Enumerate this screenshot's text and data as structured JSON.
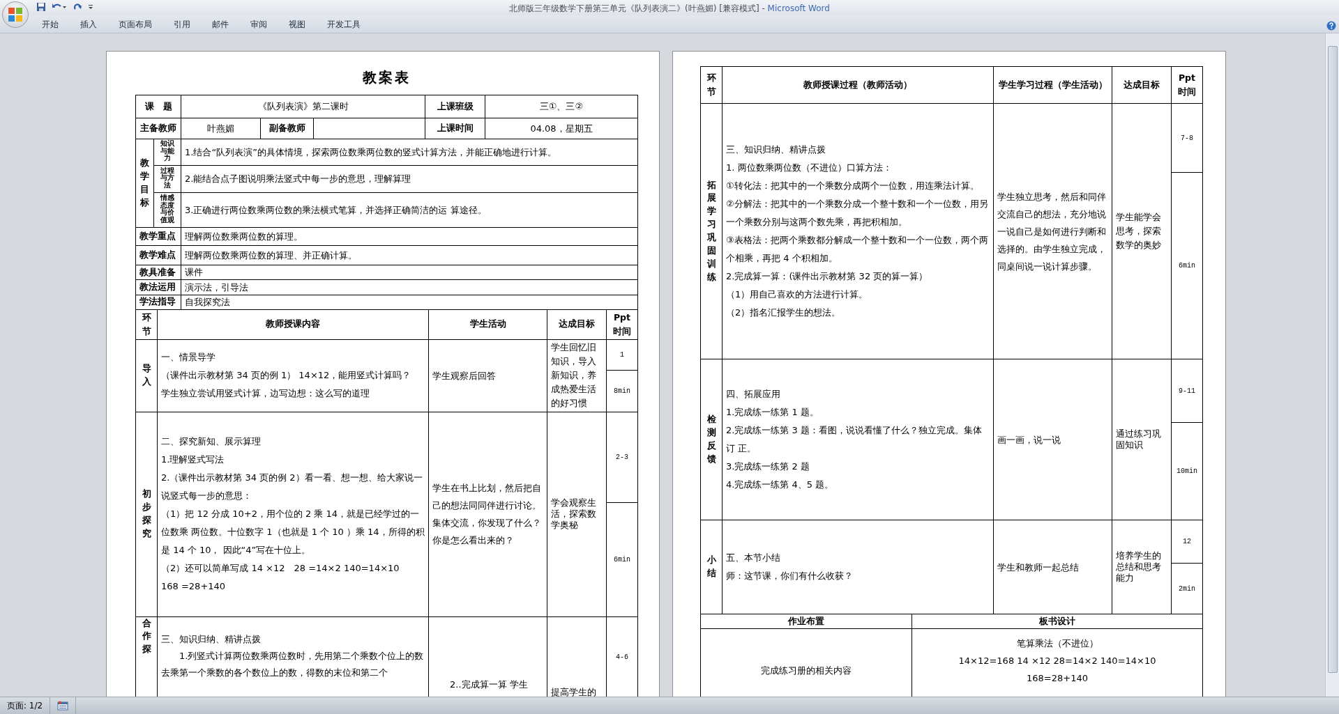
{
  "window": {
    "title": "北师版三年级数学下册第三单元《队列表演二》(叶燕媚) [兼容模式] -",
    "app_name": "Microsoft Word"
  },
  "ribbon_tabs": [
    {
      "label": "开始",
      "selected": false
    },
    {
      "label": "插入",
      "selected": false
    },
    {
      "label": "页面布局",
      "selected": false
    },
    {
      "label": "引用",
      "selected": false
    },
    {
      "label": "邮件",
      "selected": false
    },
    {
      "label": "审阅",
      "selected": false
    },
    {
      "label": "视图",
      "selected": false
    },
    {
      "label": "开发工具",
      "selected": false
    }
  ],
  "page_1": {
    "heading": "教案表",
    "info": {
      "topic_label": "课　题",
      "topic": "《队列表演》第二课时",
      "class_label": "上课班级",
      "class": "三①、三②",
      "lead_label": "主备教师",
      "lead": "叶燕媚",
      "assist_label": "副备教师",
      "time_label": "上课时间",
      "time": "04.08，星期五"
    },
    "objectives": {
      "label": "教学目标",
      "items": [
        {
          "category": "知识与能力",
          "text": "1.结合“队列表演”的具体情境，探索两位数乘两位数的竖式计算方法，并能正确地进行计算。"
        },
        {
          "category": "过程与方法",
          "text": "2.能结合点子图说明乘法竖式中每一步的意思，理解算理"
        },
        {
          "category": "情感态度与价值观",
          "text": "3.正确进行两位数乘两位数的乘法横式笔算，并选择正确简洁的运 算途径。"
        }
      ]
    },
    "info_rows": [
      {
        "label": "教学重点",
        "value": "理解两位数乘两位数的算理。"
      },
      {
        "label": "教学难点",
        "value": "理解两位数乘两位数的算理、并正确计算。"
      },
      {
        "label": "教具准备",
        "value": "课件"
      },
      {
        "label": "教法运用",
        "value": "演示法，引导法"
      },
      {
        "label": "学法指导",
        "value": "自我探究法"
      }
    ],
    "process": {
      "columns": [
        "环节",
        "教师授课内容",
        "学生活动",
        "达成目标",
        "Ppt 时间"
      ],
      "rows": [
        {
          "stage": "导入",
          "teacher": [
            "一、情景导学",
            "（课件出示教材第 34 页的例 1） 14×12，能用竖式计算吗？",
            "学生独立尝试用竖式计算，边写边想：这么写的道理"
          ],
          "student": [
            "学生观察后回答"
          ],
          "goal": "学生回忆旧知识，导入新知识，养成热爱生活的好习惯",
          "ppt": [
            "1",
            "8min"
          ]
        },
        {
          "stage": "初步探究",
          "teacher": [
            "二、探究新知、展示算理",
            "1.理解竖式写法",
            "2.（课件出示教材第 34 页的例 2）看一看、想一想、给大家说一说竖式每一步的意思：",
            "（1）把 12 分成 10+2，用个位的 2 乘 14，就是已经学过的一位数乘 两位数。十位数字 1（也就是 1 个 10 ）乘 14，所得的积是 14 个 10， 因此“4”写在十位上。",
            "（2）还可以简单写成 14 ×12　28 =14×2 140=14×10",
            "168 =28+140"
          ],
          "student": [
            "学生在书上比划，然后把自己的想法同同伴进行讨论。",
            "集体交流，你发现了什么？你是怎么看出来的？"
          ],
          "goal": "学会观察生活，探索数学奥秘",
          "ppt": [
            "2-3",
            "6min"
          ]
        },
        {
          "stage": "合作探",
          "teacher": [
            "三、知识归纳、精讲点拨",
            "1.列竖式计算两位数乘两位数时，先用第二个乘数个位上的数去乘第一个乘数的各个数位上的数，得数的末位和第二个"
          ],
          "student": [
            "2..完成算一算 学生"
          ],
          "goal": "提高学生的",
          "ppt": [
            "4-6"
          ]
        }
      ]
    }
  },
  "page_2": {
    "process": {
      "columns": [
        "环节",
        "教师授课过程（教师活动）",
        "学生学习过程（学生活动）",
        "达成目标",
        "Ppt 时间"
      ],
      "rows": [
        {
          "stage": "拓展学习巩固训练",
          "teacher": [
            "三、知识归纳、精讲点拨",
            "1. 两位数乘两位数（不进位）口算方法：",
            "①转化法：把其中的一个乘数分成两个一位数，用连乘法计算。",
            "②分解法：把其中的一个乘数分成一个整十数和一个一位数，用另一个乘数分别与这两个数先乘，再把积相加。",
            "③表格法：把两个乘数都分解成一个整十数和一个一位数，两个两个相乘，再把 4 个积相加。",
            "2.完成算一算：(课件出示教材第 32 页的算一算）",
            "（1）用自己喜欢的方法进行计算。",
            "（2）指名汇报学生的想法。"
          ],
          "student": [
            "学生独立思考，然后和同伴交流自己的想法，充分地说一说自己是如何进行判断和选择的。由学生独立完成，同桌间说一说计算步骤。"
          ],
          "goal": "学生能学会思考，探索数学的奥妙",
          "ppt": [
            "7-8",
            "6min"
          ]
        },
        {
          "stage": "检测反馈",
          "teacher": [
            "四、拓展应用",
            "1.完成练一练第 1 题。",
            "2.完成练一练第 3 题：看图，说说看懂了什么？独立完成。集体订 正。",
            "3.完成练一练第 2 题",
            "4.完成练一练第 4、5 题。"
          ],
          "student": [
            "画一画，说一说"
          ],
          "goal": "通过练习巩固知识",
          "ppt": [
            "9-11",
            "10min"
          ]
        },
        {
          "stage": "小结",
          "teacher": [
            "五、本节小结",
            "师：这节课，你们有什么收获？"
          ],
          "student": [
            "学生和教师一起总结"
          ],
          "goal": "培养学生的总结和思考能力",
          "ppt": [
            "12",
            "2min"
          ]
        }
      ]
    },
    "homework": {
      "label": "作业布置",
      "text": "完成练习册的相关内容"
    },
    "board": {
      "label": "板书设计",
      "lines": [
        "笔算乘法（不进位）",
        "14×12=168 14 ×12 28=14×2 140=14×10",
        "168=28+140"
      ]
    }
  },
  "status_bar": {
    "page": "页面: 1/2"
  }
}
